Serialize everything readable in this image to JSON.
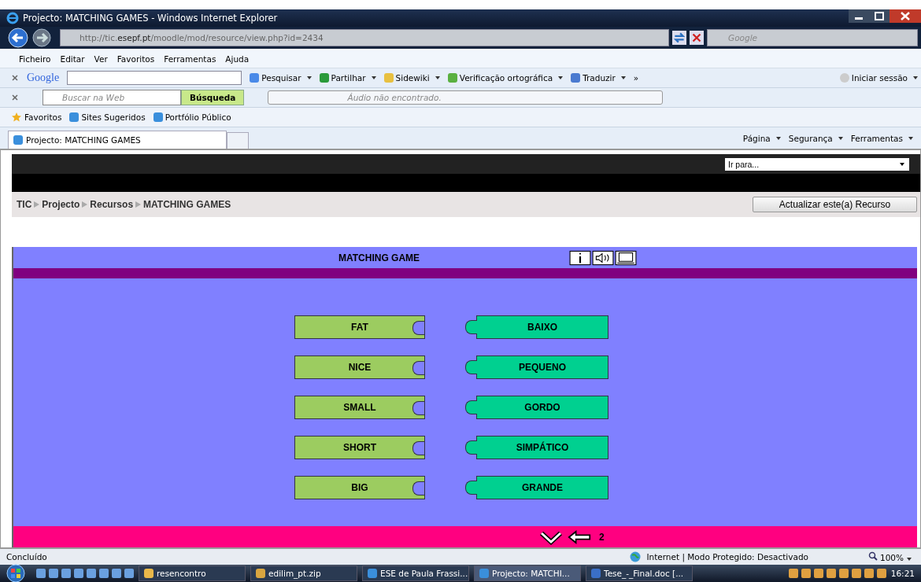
{
  "window": {
    "title": "Projecto: MATCHING GAMES - Windows Internet Explorer"
  },
  "address_bar": {
    "url_prefix": "http://tic.",
    "url_domain": "esepf.pt",
    "url_path": "/moodle/mod/resource/view.php?id=2434"
  },
  "search_box": {
    "placeholder": "Google"
  },
  "menu": [
    "Ficheiro",
    "Editar",
    "Ver",
    "Favoritos",
    "Ferramentas",
    "Ajuda"
  ],
  "google_toolbar": {
    "logo": "Google",
    "items": [
      {
        "kind": "search",
        "label": "Pesquisar"
      },
      {
        "kind": "share",
        "label": "Partilhar"
      },
      {
        "kind": "sidewiki",
        "label": "Sidewiki"
      },
      {
        "kind": "spell",
        "label": "Verificação ortográfica"
      },
      {
        "kind": "translate",
        "label": "Traduzir"
      }
    ],
    "more": "»",
    "signin": "Iniciar sessão"
  },
  "search_toolbar": {
    "placeholder": "Buscar na Web",
    "button": "Búsqueda",
    "audio": "Áudio não encontrado."
  },
  "favorites_bar": {
    "favorites": "Favoritos",
    "items": [
      "Sites Sugeridos",
      "Portfólio Público"
    ]
  },
  "tabs": [
    {
      "label": "Projecto: MATCHING GAMES",
      "selected": true
    }
  ],
  "command_bar": [
    "Página",
    "Segurança",
    "Ferramentas"
  ],
  "page": {
    "jump_menu": "Ir para...",
    "breadcrumb": [
      "TIC",
      "Projecto",
      "Recursos",
      "MATCHING GAMES"
    ],
    "update_button": "Actualizar este(a) Recurso",
    "game": {
      "title": "MATCHING GAME",
      "pairs": [
        {
          "left": "FAT",
          "right": "BAIXO"
        },
        {
          "left": "NICE",
          "right": "PEQUENO"
        },
        {
          "left": "SMALL",
          "right": "GORDO"
        },
        {
          "left": "SHORT",
          "right": "SIMPÁTICO"
        },
        {
          "left": "BIG",
          "right": "GRANDE"
        }
      ],
      "page_number": "2"
    }
  },
  "status_bar": {
    "text": "Concluído",
    "zone": "Internet | Modo Protegido: Desactivado",
    "zoom": "100%"
  },
  "taskbar": {
    "items": [
      {
        "kind": "folder",
        "label": "resencontro",
        "selected": false
      },
      {
        "kind": "zip",
        "label": "edilim_pt.zip",
        "selected": false
      },
      {
        "kind": "ie",
        "label": "ESE de Paula Frassi...",
        "selected": false
      },
      {
        "kind": "ie",
        "label": "Projecto: MATCHI...",
        "selected": true
      },
      {
        "kind": "doc",
        "label": "Tese_-_Final.doc [...",
        "selected": false
      }
    ],
    "clock": "16:21"
  }
}
